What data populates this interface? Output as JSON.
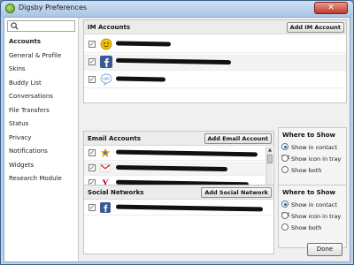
{
  "window": {
    "title": "Digsby Preferences",
    "close_glyph": "✕"
  },
  "search": {
    "placeholder": ""
  },
  "sidebar": {
    "items": [
      {
        "label": "Accounts",
        "active": true
      },
      {
        "label": "General & Profile"
      },
      {
        "label": "Skins"
      },
      {
        "label": "Buddy List"
      },
      {
        "label": "Conversations"
      },
      {
        "label": "File Transfers"
      },
      {
        "label": "Status"
      },
      {
        "label": "Privacy"
      },
      {
        "label": "Notifications"
      },
      {
        "label": "Widgets"
      },
      {
        "label": "Research Module"
      }
    ]
  },
  "im_accounts": {
    "title": "IM Accounts",
    "add_label": "Add IM Account",
    "rows": [
      {
        "service": "yahoo-icon",
        "checked": true
      },
      {
        "service": "facebook-icon",
        "checked": true
      },
      {
        "service": "gtalk-icon",
        "checked": true
      }
    ]
  },
  "email_accounts": {
    "title": "Email Accounts",
    "add_label": "Add Email Account",
    "rows": [
      {
        "service": "hotmail-icon",
        "checked": true
      },
      {
        "service": "gmail-icon",
        "checked": true
      },
      {
        "service": "yahoo-mail-icon",
        "checked": true
      }
    ]
  },
  "social_networks": {
    "title": "Social Networks",
    "add_label": "Add Social Network",
    "rows": [
      {
        "service": "facebook-icon",
        "checked": true
      }
    ]
  },
  "email_where": {
    "title": "Where to Show",
    "options": [
      "Show in contact list",
      "Show icon in tray",
      "Show both"
    ],
    "selected": "Show in contact list"
  },
  "social_where": {
    "title": "Where to Show",
    "options": [
      "Show in contact list",
      "Show icon in tray",
      "Show both"
    ],
    "selected": "Show in contact list"
  },
  "done_label": "Done",
  "checkmark": "✓"
}
